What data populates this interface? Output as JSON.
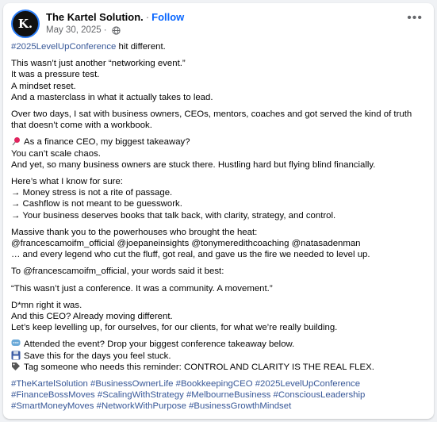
{
  "post": {
    "author": "The Kartel Solution.",
    "avatar_text": "K.",
    "follow_label": "Follow",
    "date": "May 30, 2025",
    "dot": "·",
    "more_icon": "•••",
    "hashtag_intro": "#2025LevelUpConference",
    "intro_rest": " hit different.",
    "para1": [
      "This wasn’t just another “networking event.”",
      "It was a pressure test.",
      "A mindset reset.",
      "And a masterclass in what it actually takes to lead."
    ],
    "para2": "Over two days, I sat with business owners, CEOs, mentors, coaches and got served the kind of truth that doesn’t come with a workbook.",
    "para3": [
      "As a finance CEO, my biggest takeaway?",
      "You can’t scale chaos.",
      "And yet, so many business owners are stuck there. Hustling hard but flying blind financially."
    ],
    "para4": [
      "Here’s what I know for sure:",
      "→ Money stress is not a rite of passage.",
      "→ Cashflow is not meant to be guesswork.",
      "→ Your business deserves books that talk back, with clarity, strategy, and control."
    ],
    "para5": [
      "Massive thank you to the powerhouses who brought the heat:",
      "@francescamoifm_official @joepaneinsights @tonymeredithcoaching @natasadenman",
      "… and every legend who cut the fluff, got real, and gave us the fire we needed to level up."
    ],
    "para6": "To @francescamoifm_official, your words said it best:",
    "para7": "“This wasn’t just a conference. It was a community. A movement.”",
    "para8": [
      "D*mn right it was.",
      "And this CEO? Already moving different.",
      "Let’s keep levelling up, for ourselves, for our clients, for what we’re really building."
    ],
    "cta": [
      "Attended the event? Drop your biggest conference takeaway below.",
      "Save this for the days you feel stuck.",
      "Tag someone who needs this reminder: CONTROL AND CLARITY IS THE REAL FLEX."
    ],
    "hashtags": [
      "#TheKartelSolution #BusinessOwnerLife #BookkeepingCEO #2025LevelUpConference",
      "#FinanceBossMoves #ScalingWithStrategy #MelbourneBusiness #ConsciousLeadership",
      "#SmartMoneyMoves #NetworkWithPurpose #BusinessGrowthMindset"
    ]
  },
  "colors": {
    "link": "#385898",
    "follow": "#0866ff",
    "muted": "#65676b"
  }
}
